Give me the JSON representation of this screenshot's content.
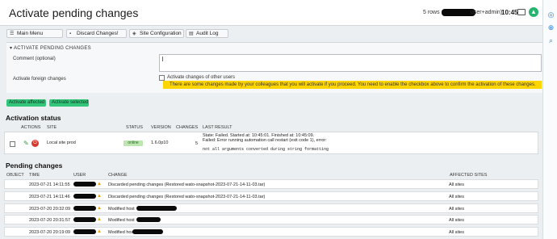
{
  "header": {
    "title": "Activate pending changes",
    "rows": "5 rows",
    "user_suffix": "user+admin)",
    "time": "10:45"
  },
  "toolbar": {
    "main_menu": "Main Menu",
    "discard": "Discard Changes!",
    "site_config": "Site Configuration",
    "audit_log": "Audit Log"
  },
  "activate_panel": {
    "heading": "ACTIVATE PENDING CHANGES",
    "comment_label": "Comment (optional)",
    "comment_value": "",
    "foreign_label": "Activate foreign changes",
    "other_users_label": "Activate changes of other users",
    "warning": "There are some changes made by your colleagues that you will activate if you proceed. You need to enable the checkbox above to confirm the activation of these changes."
  },
  "actions": {
    "affected": "Activate affected",
    "selected": "Activate selected"
  },
  "activation_status": {
    "heading": "Activation status",
    "columns": [
      "ACTIONS",
      "SITE",
      "STATUS",
      "VERSION",
      "CHANGES",
      "LAST RESULT"
    ],
    "row": {
      "site": "Local site prod",
      "status": "online",
      "version": "1.6.0p10",
      "changes": "5",
      "result_line1": "State: Failed. Started at: 10:45:01. Finished at: 10:45:09.",
      "result_line2": "Failed: Error running automation call restart (exit code 1), error:",
      "result_line3": "not all arguments converted during string formatting"
    }
  },
  "pending_changes": {
    "heading": "Pending changes",
    "columns": [
      "OBJECT",
      "TIME",
      "USER",
      "CHANGE",
      "AFFECTED SITES"
    ],
    "rows": [
      {
        "time": "2023-07-21 14:11:55",
        "change": "Discarded pending changes (Restored wato-snapshot-2023-07-21-14-11-03.tar)",
        "sites": "All sites"
      },
      {
        "time": "2023-07-21 14:11:46",
        "change": "Discarded pending changes (Restored wato-snapshot-2023-07-21-14-11-03.tar)",
        "sites": "All sites"
      },
      {
        "time": "2023-07-20 20:32:09",
        "change": "Modified host",
        "sites": "All sites"
      },
      {
        "time": "2023-07-20 20:31:57",
        "change": "Modified host",
        "sites": "All sites"
      },
      {
        "time": "2023-07-20 20:19:09",
        "change": "Modified host",
        "sites": "All sites"
      }
    ]
  },
  "icons": {
    "side": [
      "globe-icon",
      "plus-icon",
      "search-icon"
    ],
    "row_warning": "warning-icon"
  },
  "colors": {
    "accent_green": "#33c57a",
    "warning_yellow": "#ffd500",
    "remove_red": "#d63a2f"
  }
}
